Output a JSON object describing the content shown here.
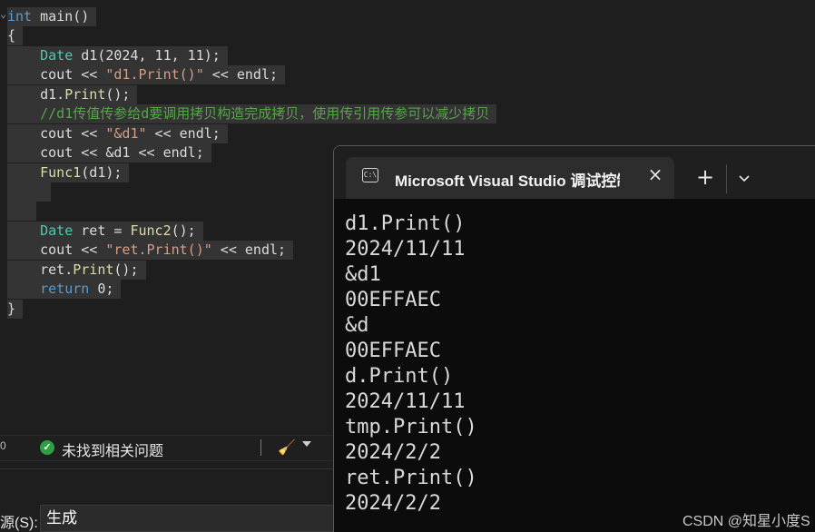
{
  "editor": {
    "lines": [
      {
        "spans": [
          {
            "t": "int",
            "c": "kw"
          },
          {
            "t": " main()",
            "c": "plain"
          }
        ]
      },
      {
        "spans": [
          {
            "t": "{",
            "c": "plain"
          }
        ]
      },
      {
        "spans": [
          {
            "t": "    Date",
            "c": "type"
          },
          {
            "t": " d1(2024, 11, 11);",
            "c": "plain"
          }
        ]
      },
      {
        "spans": [
          {
            "t": "    cout << ",
            "c": "plain"
          },
          {
            "t": "\"d1.Print()\"",
            "c": "str"
          },
          {
            "t": " << endl;",
            "c": "plain"
          }
        ]
      },
      {
        "spans": [
          {
            "t": "    d1.",
            "c": "plain"
          },
          {
            "t": "Print",
            "c": "fn"
          },
          {
            "t": "();",
            "c": "plain"
          }
        ]
      },
      {
        "spans": [
          {
            "t": "    //d1传值传参给d要调用拷贝构造完成拷贝，使用传引用传参可以减少拷贝",
            "c": "cmt"
          }
        ]
      },
      {
        "spans": [
          {
            "t": "    cout << ",
            "c": "plain"
          },
          {
            "t": "\"&d1\"",
            "c": "str"
          },
          {
            "t": " << endl;",
            "c": "plain"
          }
        ]
      },
      {
        "spans": [
          {
            "t": "    cout << &d1 << endl;",
            "c": "plain"
          }
        ]
      },
      {
        "spans": [
          {
            "t": "    ",
            "c": "plain"
          },
          {
            "t": "Func1",
            "c": "fn"
          },
          {
            "t": "(d1);",
            "c": "plain"
          }
        ]
      },
      {
        "spans": [
          {
            "t": "",
            "c": "plain"
          }
        ]
      },
      {
        "spans": [
          {
            "t": "",
            "c": "plain"
          }
        ]
      },
      {
        "spans": [
          {
            "t": "    Date",
            "c": "type"
          },
          {
            "t": " ret = ",
            "c": "plain"
          },
          {
            "t": "Func2",
            "c": "fn"
          },
          {
            "t": "();",
            "c": "plain"
          }
        ]
      },
      {
        "spans": [
          {
            "t": "    cout << ",
            "c": "plain"
          },
          {
            "t": "\"ret.Print()\"",
            "c": "str"
          },
          {
            "t": " << endl;",
            "c": "plain"
          }
        ]
      },
      {
        "spans": [
          {
            "t": "    ret.",
            "c": "plain"
          },
          {
            "t": "Print",
            "c": "fn"
          },
          {
            "t": "();",
            "c": "plain"
          }
        ]
      },
      {
        "spans": [
          {
            "t": "    ",
            "c": "plain"
          },
          {
            "t": "return",
            "c": "kw"
          },
          {
            "t": " 0;",
            "c": "plain"
          }
        ]
      },
      {
        "spans": [
          {
            "t": "}",
            "c": "plain"
          }
        ]
      }
    ]
  },
  "status_bar": {
    "left_glyph": "0",
    "issues_label": "未找到相关问题"
  },
  "output_panel": {
    "source_label": "源(S):",
    "source_value": "生成"
  },
  "terminal": {
    "tab_title": "Microsoft Visual Studio 调试控制台",
    "app_icon_text": "C:\\",
    "lines": [
      "d1.Print()",
      "2024/11/11",
      "&d1",
      "00EFFAEC",
      "&d",
      "00EFFAEC",
      "d.Print()",
      "2024/11/11",
      "tmp.Print()",
      "2024/2/2",
      "ret.Print()",
      "2024/2/2"
    ]
  },
  "watermark": "CSDN @知星小度S",
  "colors": {
    "editor_bg": "#1e1e1e",
    "terminal_bg": "#0c0c0c",
    "keyword": "#569cd6",
    "type": "#4ec9b0",
    "function": "#dcdcaa",
    "string": "#d69d85",
    "comment": "#57a64a",
    "status_ok": "#2ea043"
  },
  "icons": {
    "status_ok": "check-circle-icon",
    "status_broom": "broom-icon",
    "tab_app": "console-app-icon",
    "tab_close": "close-icon",
    "new_tab": "plus-icon",
    "dropdown": "chevron-down-icon"
  }
}
